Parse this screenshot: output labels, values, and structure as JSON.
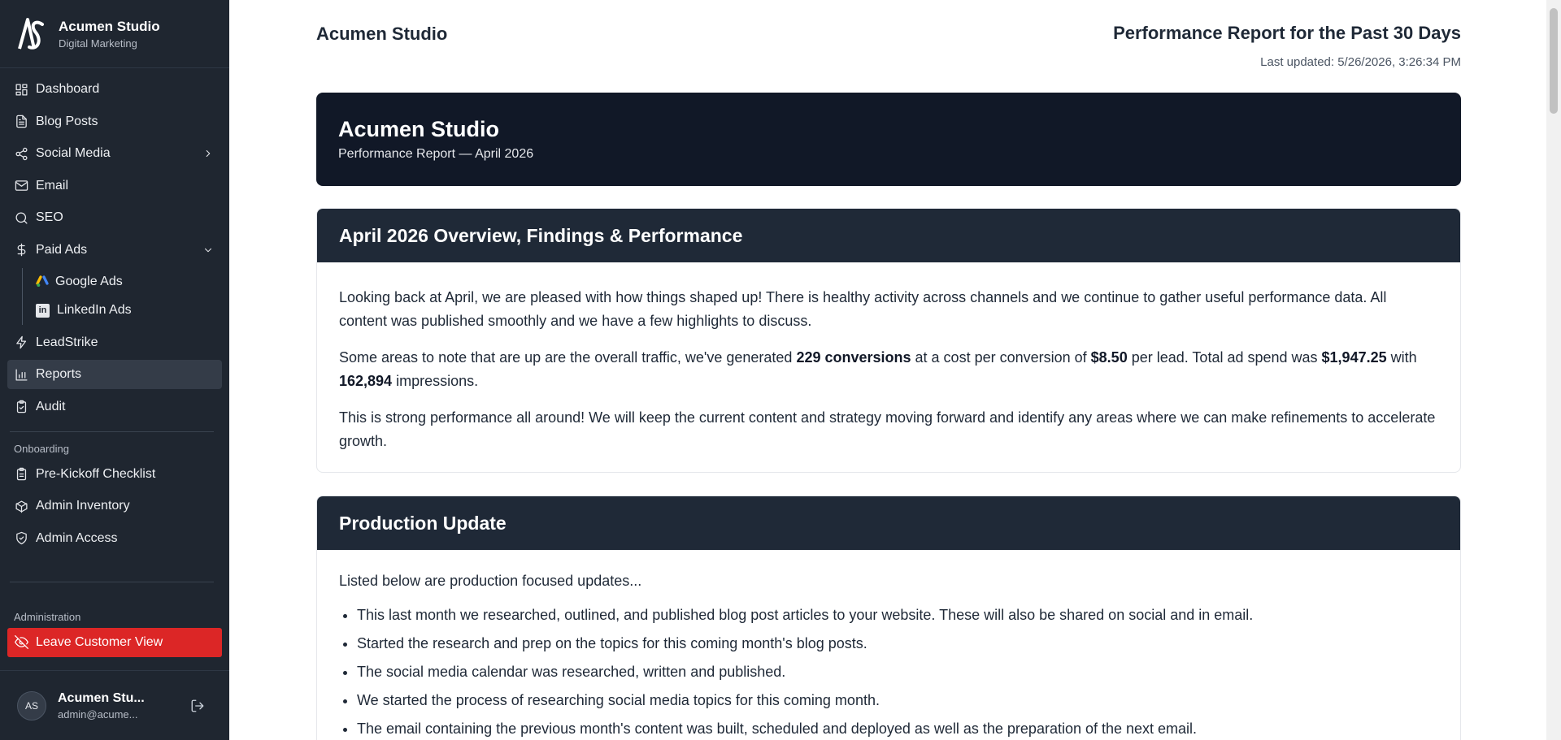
{
  "brand": {
    "logo": "AS",
    "name": "Acumen Studio",
    "subtitle": "Digital Marketing"
  },
  "nav": {
    "items": [
      {
        "label": "Dashboard",
        "icon": "grid-icon"
      },
      {
        "label": "Blog Posts",
        "icon": "document-icon"
      },
      {
        "label": "Social Media",
        "icon": "share-icon"
      },
      {
        "label": "Email",
        "icon": "mail-icon"
      },
      {
        "label": "SEO",
        "icon": "search-icon"
      },
      {
        "label": "Paid Ads",
        "icon": "dollar-icon"
      }
    ],
    "sub_items": [
      {
        "label": "Google Ads",
        "icon": "google-ads-icon"
      },
      {
        "label": "LinkedIn Ads",
        "icon": "linkedin-icon"
      }
    ],
    "items2": [
      {
        "label": "LeadStrike",
        "icon": "bolt-icon"
      },
      {
        "label": "Reports",
        "icon": "bar-chart-icon",
        "active": true
      },
      {
        "label": "Audit",
        "icon": "clipboard-check-icon"
      }
    ]
  },
  "onboarding": {
    "label": "Onboarding",
    "items": [
      {
        "label": "Pre-Kickoff Checklist",
        "icon": "clipboard-icon"
      },
      {
        "label": "Admin Inventory",
        "icon": "box-icon"
      },
      {
        "label": "Admin Access",
        "icon": "shield-icon"
      }
    ]
  },
  "administration": {
    "label": "Administration",
    "leave_label": "Leave Customer View"
  },
  "user": {
    "initials": "AS",
    "name": "Acumen Stu...",
    "email": "admin@acume..."
  },
  "header": {
    "client": "Acumen Studio",
    "title": "Performance Report for the Past 30 Days",
    "updated": "Last updated: 5/26/2026, 3:26:34 PM"
  },
  "hero": {
    "title": "Acumen Studio",
    "subtitle": "Performance Report — April 2026"
  },
  "overview": {
    "title": "April 2026 Overview, Findings & Performance",
    "p1": "Looking back at April, we are pleased with how things shaped up! There is healthy activity across channels and we continue to gather useful performance data. All content was published smoothly and we have a few highlights to discuss.",
    "p2_a": "Some areas to note that are up are the overall traffic, we've generated ",
    "p2_conversions": "229 conversions",
    "p2_b": " at a cost per conversion of ",
    "p2_cpl": "$8.50",
    "p2_c": " per lead. Total ad spend was ",
    "p2_spend": "$1,947.25",
    "p2_d": " with ",
    "p2_impressions": "162,894",
    "p2_e": " impressions.",
    "p3": "This is strong performance all around! We will keep the current content and strategy moving forward and identify any areas where we can make refinements to accelerate growth."
  },
  "production": {
    "title": "Production Update",
    "intro": "Listed below are production focused updates...",
    "bullets": [
      "This last month we researched, outlined, and published blog post articles to your website. These will also be shared on social and in email.",
      "Started the research and prep on the topics for this coming month's blog posts.",
      "The social media calendar was researched, written and published.",
      "We started the process of researching social media topics for this coming month.",
      "The email containing the previous month's content was built, scheduled and deployed as well as the preparation of the next email."
    ]
  },
  "colors": {
    "sidebar_bg": "#1f2630",
    "hero_bg": "#111827",
    "card_head_bg": "#1f2937",
    "danger": "#dc2626"
  }
}
